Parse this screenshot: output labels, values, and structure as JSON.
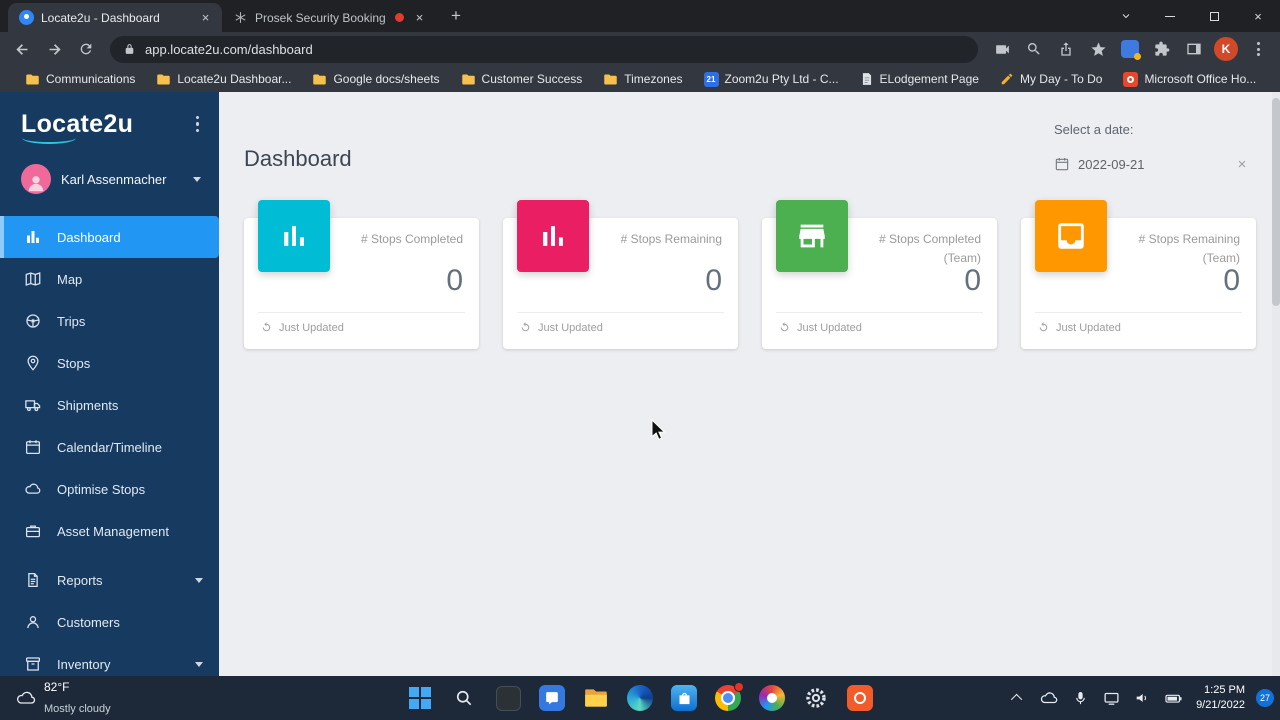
{
  "colors": {
    "sidebar_bg": "#173a61",
    "active_item_blue": "#2196f3",
    "browser_frame": "#1f2124",
    "content_bg": "#edeef2"
  },
  "browser": {
    "tab1": {
      "title": "Locate2u - Dashboard"
    },
    "tab2": {
      "title": "Prosek Security Booking"
    },
    "url": "app.locate2u.com/dashboard",
    "profile_initial": "K",
    "bookmarks": [
      {
        "label": "Communications",
        "icon": "folder-icon"
      },
      {
        "label": "Locate2u Dashboar...",
        "icon": "folder-icon"
      },
      {
        "label": "Google docs/sheets",
        "icon": "folder-icon"
      },
      {
        "label": "Customer Success",
        "icon": "folder-icon"
      },
      {
        "label": "Timezones",
        "icon": "folder-icon"
      },
      {
        "label": "Zoom2u Pty Ltd - C...",
        "icon": "zoom2u-favicon",
        "badge": "21"
      },
      {
        "label": "ELodgement Page",
        "icon": "page-favicon"
      },
      {
        "label": "My Day - To Do",
        "icon": "pencil-icon"
      },
      {
        "label": "Microsoft Office Ho...",
        "icon": "office-favicon"
      }
    ]
  },
  "sidebar": {
    "logo": "Locate2u",
    "user": {
      "name": "Karl Assenmacher"
    },
    "items": [
      {
        "label": "Dashboard",
        "icon": "dashboard-icon",
        "active": true
      },
      {
        "label": "Map",
        "icon": "map-icon"
      },
      {
        "label": "Trips",
        "icon": "trips-icon"
      },
      {
        "label": "Stops",
        "icon": "stops-icon"
      },
      {
        "label": "Shipments",
        "icon": "shipments-icon"
      },
      {
        "label": "Calendar/Timeline",
        "icon": "calendar-icon"
      },
      {
        "label": "Optimise Stops",
        "icon": "optimise-icon"
      },
      {
        "label": "Asset Management",
        "icon": "asset-icon"
      },
      {
        "label": "Reports",
        "icon": "reports-icon",
        "expandable": true
      },
      {
        "label": "Customers",
        "icon": "customers-icon"
      },
      {
        "label": "Inventory",
        "icon": "inventory-icon",
        "expandable": true
      }
    ]
  },
  "main": {
    "title": "Dashboard",
    "date_picker": {
      "label": "Select a date:",
      "value": "2022-09-21"
    },
    "cards": [
      {
        "label": "# Stops Completed",
        "sub": "",
        "value": "0",
        "footer": "Just Updated",
        "color": "#00bcd4",
        "icon": "bar-chart-icon"
      },
      {
        "label": "# Stops Remaining",
        "sub": "",
        "value": "0",
        "footer": "Just Updated",
        "color": "#e91e63",
        "icon": "bar-chart-icon"
      },
      {
        "label": "# Stops Completed",
        "sub": "(Team)",
        "value": "0",
        "footer": "Just Updated",
        "color": "#4caf50",
        "icon": "store-icon"
      },
      {
        "label": "# Stops Remaining",
        "sub": "(Team)",
        "value": "0",
        "footer": "Just Updated",
        "color": "#ff9800",
        "icon": "inbox-icon"
      }
    ]
  },
  "taskbar": {
    "weather": {
      "temp": "82°F",
      "desc": "Mostly cloudy"
    },
    "clock": {
      "time": "1:25 PM",
      "date": "9/21/2022"
    },
    "notification_count": "27"
  }
}
